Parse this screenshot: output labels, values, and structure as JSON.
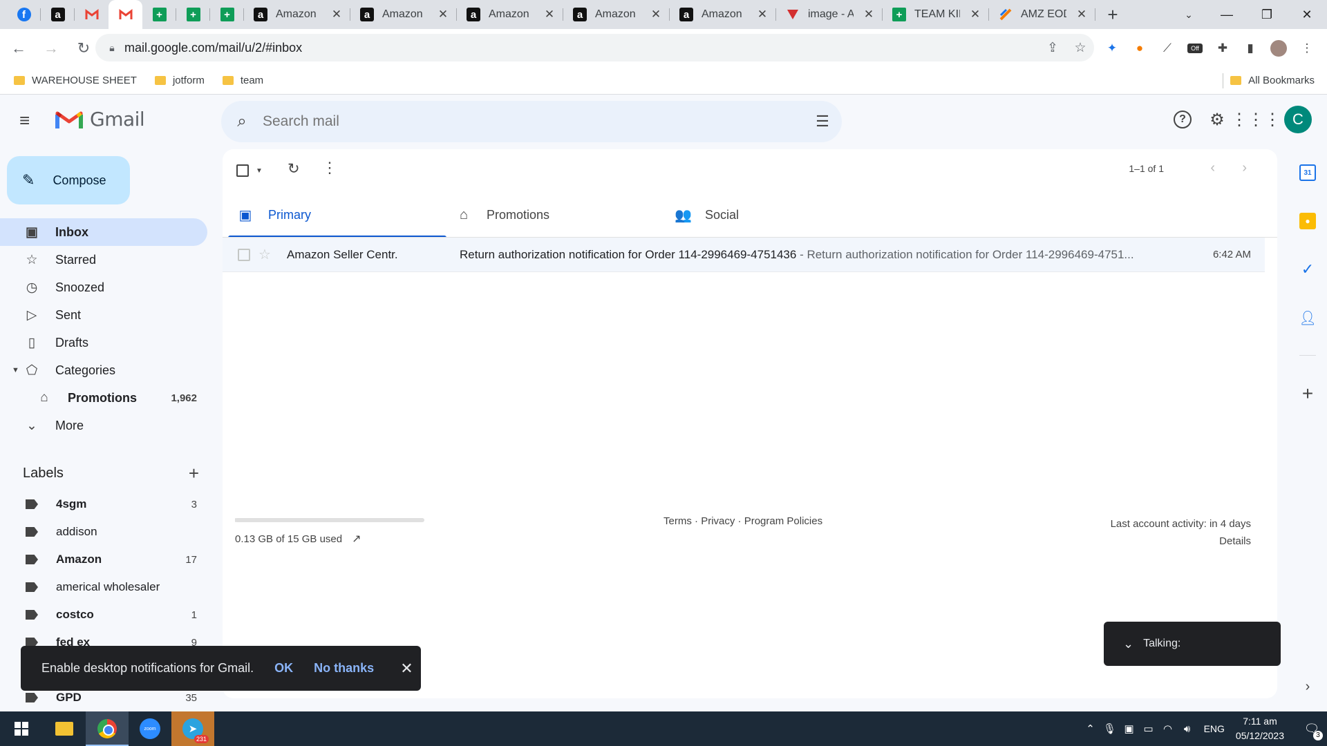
{
  "browser": {
    "tabs": [
      {
        "kind": "facebook",
        "label": ""
      },
      {
        "kind": "amazon",
        "label": ""
      },
      {
        "kind": "gmail",
        "label": ""
      },
      {
        "kind": "gmail",
        "label": "",
        "active": true
      },
      {
        "kind": "sheets",
        "label": ""
      },
      {
        "kind": "sheets",
        "label": ""
      },
      {
        "kind": "sheets",
        "label": ""
      },
      {
        "kind": "amazon",
        "label": "Amazon"
      },
      {
        "kind": "amazon",
        "label": "Amazon"
      },
      {
        "kind": "amazon",
        "label": "Amazon"
      },
      {
        "kind": "amazon",
        "label": "Amazon"
      },
      {
        "kind": "amazon",
        "label": "Amazon"
      },
      {
        "kind": "image",
        "label": "image - A"
      },
      {
        "kind": "sheets",
        "label": "TEAM KIM"
      },
      {
        "kind": "amzeod",
        "label": "AMZ EOD"
      }
    ],
    "url": "mail.google.com/mail/u/2/#inbox",
    "bookmarks": [
      "WAREHOUSE SHEET",
      "jotform",
      "team"
    ],
    "all_bookmarks": "All Bookmarks",
    "ext_badge": "Off"
  },
  "gmail": {
    "app_name": "Gmail",
    "search_placeholder": "Search mail",
    "avatar_initial": "C",
    "compose_label": "Compose",
    "nav": [
      {
        "label": "Inbox",
        "icon": "inbox-icon",
        "glyph": "▣",
        "active": true,
        "count": ""
      },
      {
        "label": "Starred",
        "icon": "star-icon",
        "glyph": "☆",
        "count": ""
      },
      {
        "label": "Snoozed",
        "icon": "clock-icon",
        "glyph": "◷",
        "count": ""
      },
      {
        "label": "Sent",
        "icon": "send-icon",
        "glyph": "▷",
        "count": ""
      },
      {
        "label": "Drafts",
        "icon": "draft-icon",
        "glyph": "▯",
        "count": ""
      },
      {
        "label": "Categories",
        "icon": "label-outline-icon",
        "glyph": "⬠",
        "count": "",
        "caret": true
      },
      {
        "label": "Promotions",
        "icon": "tag-icon",
        "glyph": "⌂",
        "count": "1,962",
        "sub": true
      },
      {
        "label": "More",
        "icon": "chevron-down-icon",
        "glyph": "⌄",
        "count": ""
      }
    ],
    "labels_heading": "Labels",
    "labels": [
      {
        "label": "4sgm",
        "count": "3",
        "bold": true
      },
      {
        "label": "addison",
        "count": "",
        "bold": false
      },
      {
        "label": "Amazon",
        "count": "17",
        "bold": true
      },
      {
        "label": "americal wholesaler",
        "count": "",
        "bold": false
      },
      {
        "label": "costco",
        "count": "1",
        "bold": true
      },
      {
        "label": "fed ex",
        "count": "9",
        "bold": true
      },
      {
        "label": "",
        "count": "",
        "bold": false
      },
      {
        "label": "GPD",
        "count": "35",
        "bold": true
      }
    ],
    "toolbar": {
      "pagination": "1–1 of 1"
    },
    "category_tabs": [
      {
        "label": "Primary",
        "icon": "inbox-tab-icon",
        "glyph": "▣",
        "active": true
      },
      {
        "label": "Promotions",
        "icon": "tag-icon",
        "glyph": "⌂"
      },
      {
        "label": "Social",
        "icon": "people-icon",
        "glyph": "👥"
      }
    ],
    "emails": [
      {
        "sender": "Amazon Seller Centr.",
        "subject": "Return authorization notification for Order 114-2996469-4751436",
        "snippet": " - Return authorization notification for Order 114-2996469-4751...",
        "time": "6:42 AM"
      }
    ],
    "footer": {
      "storage": "0.13 GB of 15 GB used",
      "storage_fraction": 0.009,
      "terms": "Terms",
      "privacy": "Privacy",
      "policies": "Program Policies",
      "activity": "Last account activity: in 4 days",
      "details": "Details"
    },
    "side_panel": {
      "calendar_day": "31"
    },
    "snackbar": {
      "message": "Enable desktop notifications for Gmail.",
      "ok": "OK",
      "no_thanks": "No thanks"
    },
    "talking": "Talking:"
  },
  "taskbar": {
    "telegram_badge": "231",
    "lang": "ENG",
    "time": "7:11 am",
    "date": "05/12/2023",
    "notifications": "3"
  }
}
